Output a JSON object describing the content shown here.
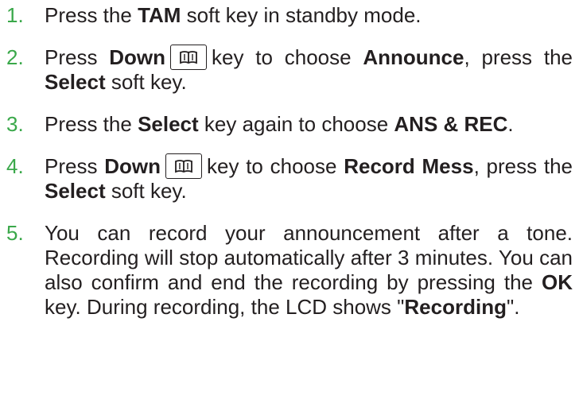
{
  "colors": {
    "number": "#3aa84a",
    "text": "#231f20",
    "background": "#ffffff"
  },
  "steps": [
    {
      "number": "1.",
      "parts": [
        "Press the ",
        "TAM",
        " soft key in standby mode."
      ]
    },
    {
      "number": "2.",
      "parts": [
        "Press ",
        "Down",
        "key to choose ",
        "Announce",
        ", press the ",
        "Select",
        " soft key."
      ],
      "key_icon": "phonebook-icon"
    },
    {
      "number": "3.",
      "parts": [
        "Press the ",
        "Select",
        " key again to choose ",
        "ANS & REC",
        "."
      ]
    },
    {
      "number": "4.",
      "parts": [
        "Press ",
        "Down",
        "key to choose ",
        "Record Mess",
        ", press the ",
        "Select",
        " soft key."
      ],
      "key_icon": "phonebook-icon"
    },
    {
      "number": "5.",
      "parts": [
        "You can record your announcement after a tone. Recording will stop automatically after 3 minutes. You can also confirm and end the recording by pressing the ",
        "OK",
        " key. During recording, the LCD shows \"",
        "Recording",
        "\"."
      ]
    }
  ]
}
